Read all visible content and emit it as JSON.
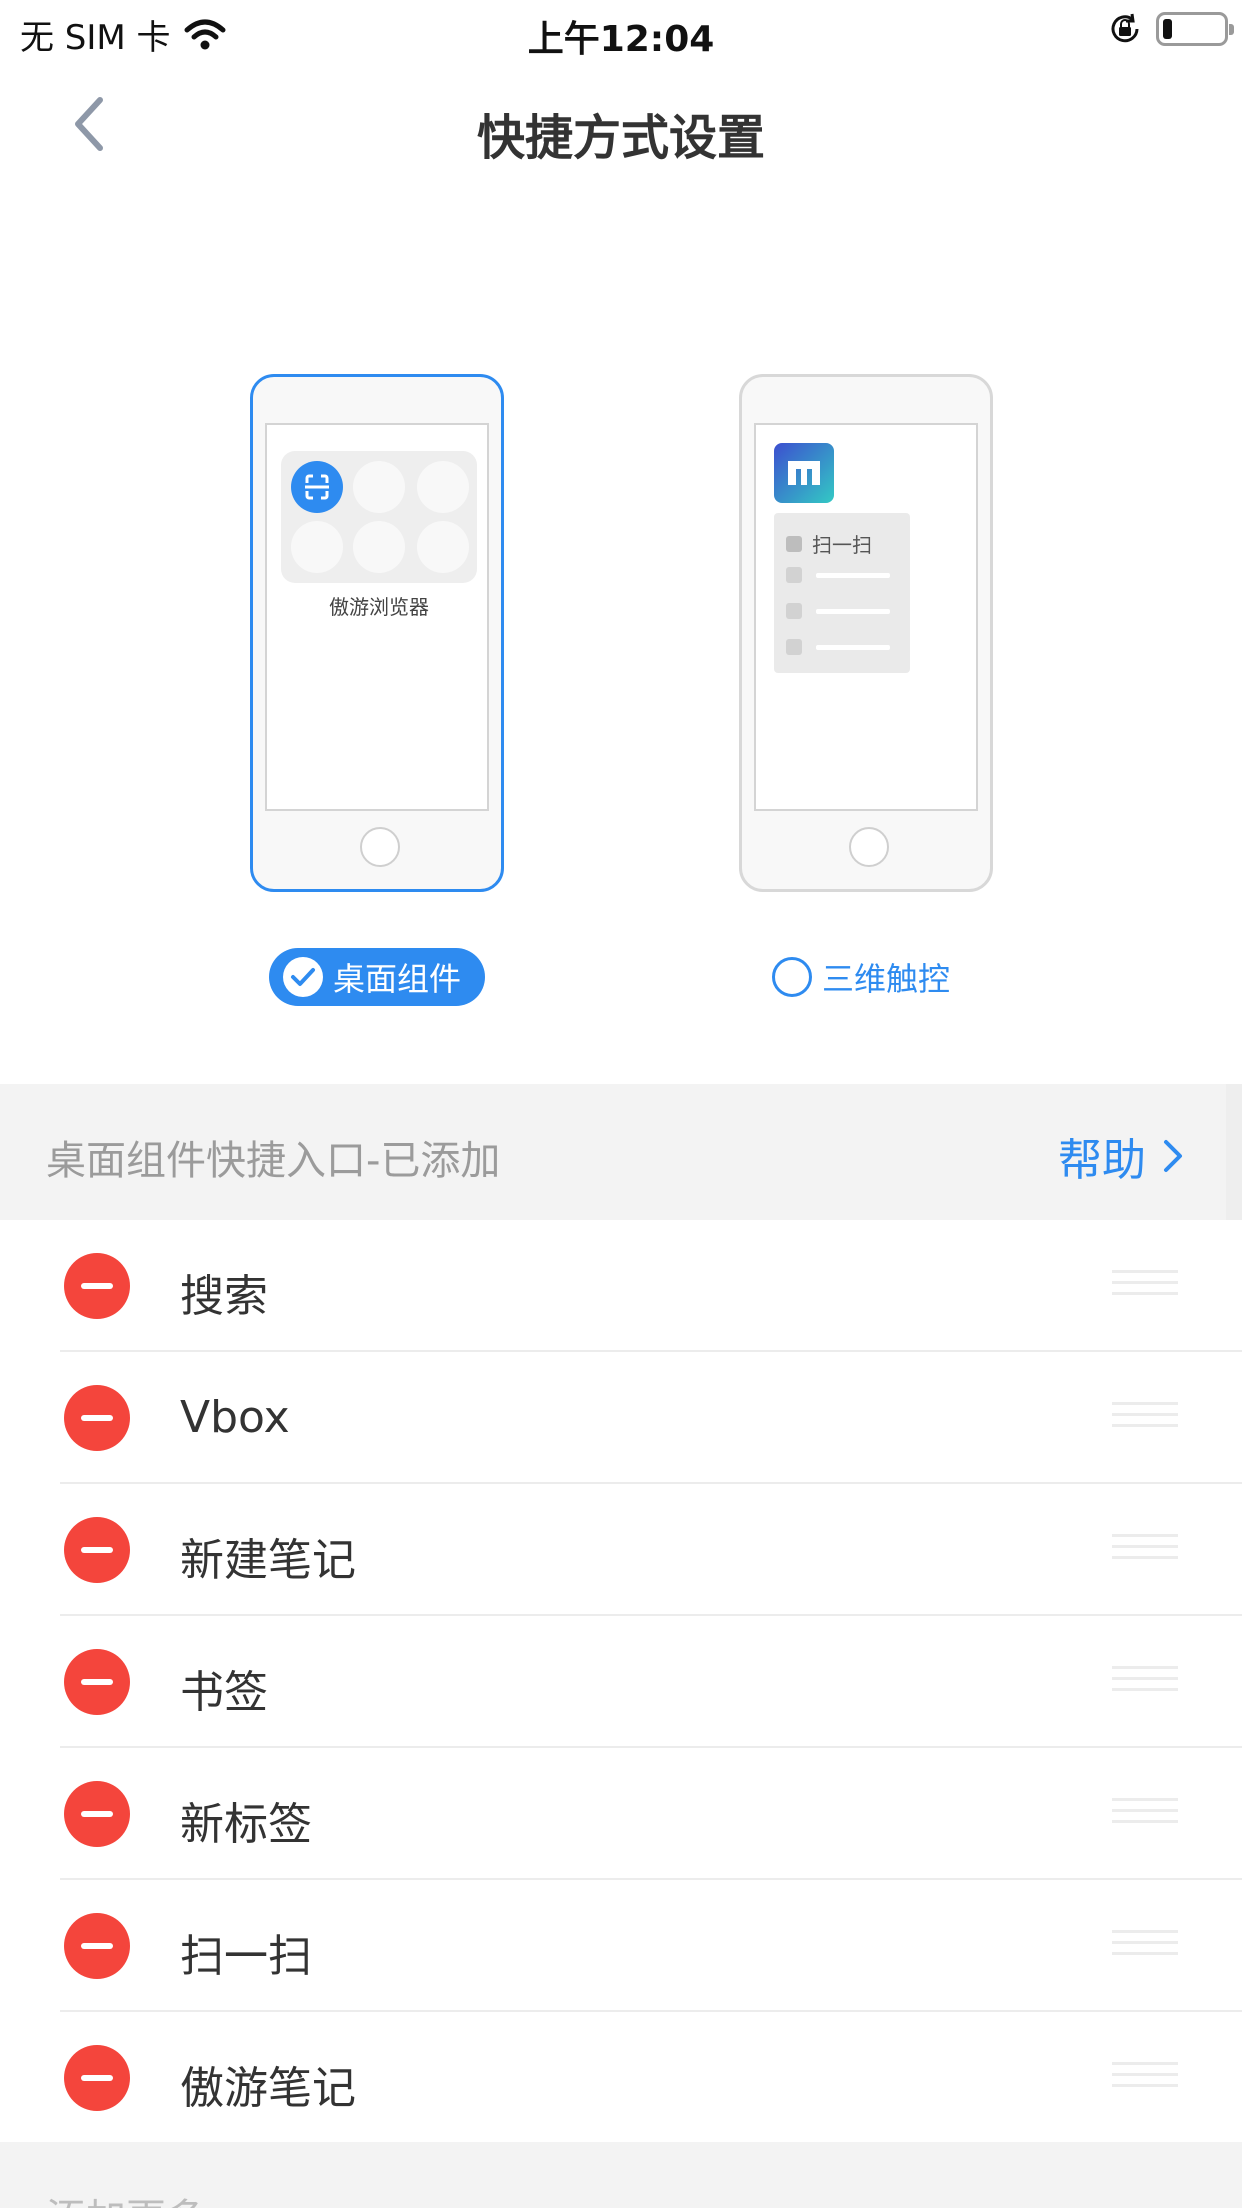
{
  "status_bar": {
    "carrier": "无 SIM 卡",
    "time": "上午12:04",
    "battery_level": 0.15
  },
  "nav": {
    "title": "快捷方式设置"
  },
  "preview": {
    "widget_app_label": "傲游浏览器",
    "touch_menu_first_item": "扫一扫"
  },
  "modes": {
    "widget": {
      "label": "桌面组件",
      "selected": true
    },
    "touch": {
      "label": "三维触控",
      "selected": false
    }
  },
  "section": {
    "title": "桌面组件快捷入口-已添加",
    "help_label": "帮助"
  },
  "items": [
    {
      "label": "搜索"
    },
    {
      "label": "Vbox"
    },
    {
      "label": "新建笔记"
    },
    {
      "label": "书签"
    },
    {
      "label": "新标签"
    },
    {
      "label": "扫一扫"
    },
    {
      "label": "傲游笔记"
    }
  ],
  "footer": {
    "title": "添加更多"
  },
  "colors": {
    "accent": "#2e8bf0",
    "delete": "#f4453c"
  }
}
